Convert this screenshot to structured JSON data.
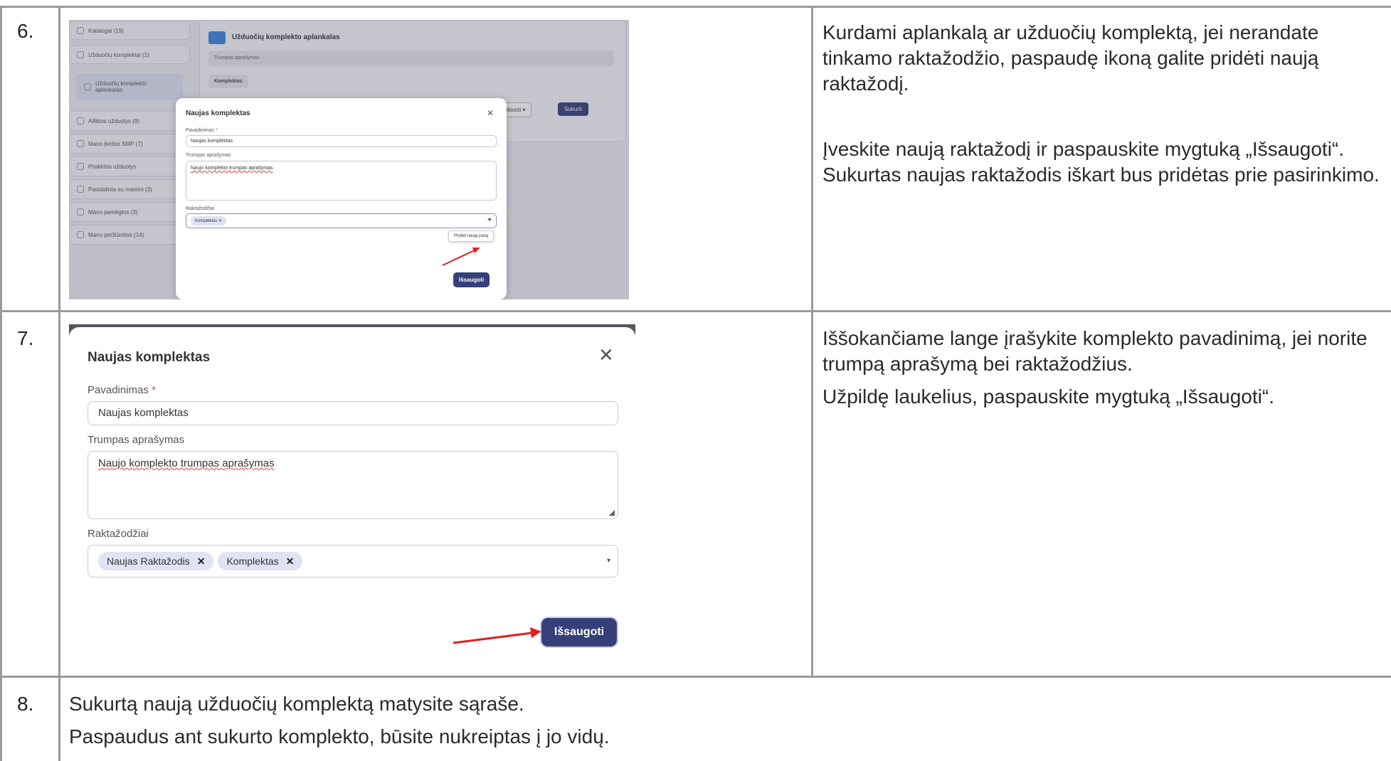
{
  "rows": [
    {
      "number": "6.",
      "paragraphs": [
        "Kurdami aplankalą ar užduočių komplektą, jei nerandate tinkamo raktažodžio, paspaudę ikoną galite pridėti naują raktažodį.",
        "Įveskite naują raktažodį ir paspauskite mygtuką „Išsaugoti“. Sukurtas naujas raktažodis iškart bus pridėtas prie pasirinkimo."
      ]
    },
    {
      "number": "7.",
      "paragraphs": [
        "Iššokančiame lange įrašykite komplekto pavadinimą, jei norite trumpą aprašymą bei raktažodžius.",
        "Užpildę laukelius, paspauskite mygtuką „Išsaugoti“."
      ]
    },
    {
      "number": "8.",
      "paragraphs": [
        "Sukurtą naują užduočių komplektą matysite sąraše.",
        "Paspaudus ant sukurto komplekto, būsite nukreiptas į jo vidų."
      ]
    }
  ],
  "screenshot6": {
    "sidebar": [
      "Katalogai (19)",
      "Užduočių komplektai (1)",
      "Užduočių komplekto aplankalas",
      "Atliktos užduotys (9)",
      "Mano įkeltos SMP (7)",
      "Priskirtos užduotys",
      "Pasidalinta su manimi (3)",
      "Mano pamėgtos (3)",
      "Mano peržiūrėtos (14)"
    ],
    "folder_title": "Užduočių komplekto aplankalas",
    "folder_desc": "Trumpas aprašymas",
    "folder_tag": "Komplektas",
    "sort_label": "Rikiuoti",
    "create_label": "Sukurti",
    "modal": {
      "title": "Naujas komplektas",
      "name_label": "Pavadinimas",
      "name_value": "Naujas komplektas",
      "desc_label": "Trumpas aprašymas",
      "desc_value": "Naujo komplekto trumpas aprašymas",
      "keywords_label": "Raktažodžiai",
      "keyword_chip": "Komplektas",
      "tooltip": "Pridėti naują įrašą",
      "save_label": "Išsaugoti"
    }
  },
  "screenshot7": {
    "title": "Naujas komplektas",
    "name_label": "Pavadinimas",
    "required_mark": "*",
    "name_value": "Naujas komplektas",
    "desc_label": "Trumpas aprašymas",
    "desc_value": "Naujo komplekto trumpas aprašymas",
    "keywords_label": "Raktažodžiai",
    "keywords": [
      "Naujas Raktažodis",
      "Komplektas"
    ],
    "save_label": "Išsaugoti"
  },
  "colors": {
    "primary_button": "#35407a",
    "arrow": "#e02020",
    "chip_bg": "#dfe3f3",
    "border": "#9a9a9a"
  }
}
